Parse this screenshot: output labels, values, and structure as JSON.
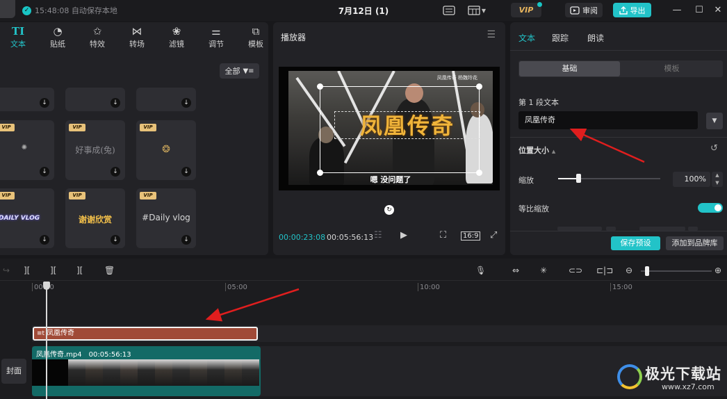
{
  "titlebar": {
    "save_status": "15:48:08 自动保存本地",
    "project_title": "7月12日 (1)",
    "vip_label": "VIP",
    "review_label": "审阅",
    "export_label": "导出"
  },
  "left_panel": {
    "tabs": [
      {
        "icon": "TI",
        "label": "文本"
      },
      {
        "icon": "◔",
        "label": "贴纸"
      },
      {
        "icon": "✩",
        "label": "特效"
      },
      {
        "icon": "⋈",
        "label": "转场"
      },
      {
        "icon": "❀",
        "label": "滤镜"
      },
      {
        "icon": "⚌",
        "label": "调节"
      },
      {
        "icon": "⧉",
        "label": "模板"
      }
    ],
    "filter_label": "全部",
    "vip_badge": "VIP",
    "tiles": [
      {
        "text": ""
      },
      {
        "text": ""
      },
      {
        "text": ""
      },
      {
        "text": "",
        "vip": true
      },
      {
        "text": "好事成(兔)",
        "vip": true
      },
      {
        "text": "",
        "vip": true
      },
      {
        "text": "DAILY VLOG",
        "vip": true
      },
      {
        "text": "谢谢欣赏",
        "vip": true
      },
      {
        "text": "#Daily vlog",
        "vip": true
      }
    ]
  },
  "player": {
    "title": "播放器",
    "overlay_title": "凤凰传奇",
    "subtitle": "嗯 没问题了",
    "watermark_tag": "凤凰传奇 杨魏玲花",
    "current_time": "00:00:23:08",
    "total_time": "00:05:56:13",
    "ratio": "16:9"
  },
  "right_panel": {
    "tabs": [
      "文本",
      "跟踪",
      "朗读"
    ],
    "segments": [
      "基础",
      "模板"
    ],
    "section_text": "第 1 段文本",
    "text_value": "凤凰传奇",
    "position_size": "位置大小",
    "scale_label": "缩放",
    "scale_value": "100%",
    "scale_fraction": 0.2,
    "uniform_label": "等比缩放",
    "uniform_on": true,
    "save_preset": "保存预设",
    "add_brand": "添加到品牌库"
  },
  "timeline": {
    "ticks": [
      "00:00",
      "05:00",
      "10:00",
      "15:00"
    ],
    "text_clip": "凤凰传奇",
    "video_name": "凤凰传奇.mp4",
    "video_duration": "00:05:56:13",
    "cover_label": "封面"
  },
  "watermark": {
    "site_name": "极光下载站",
    "site_url": "www.xz7.com"
  },
  "colors": {
    "accent": "#22c3c8",
    "arrow": "#e01e1e",
    "text_clip": "#a04a37",
    "video_clip": "#136a66"
  }
}
